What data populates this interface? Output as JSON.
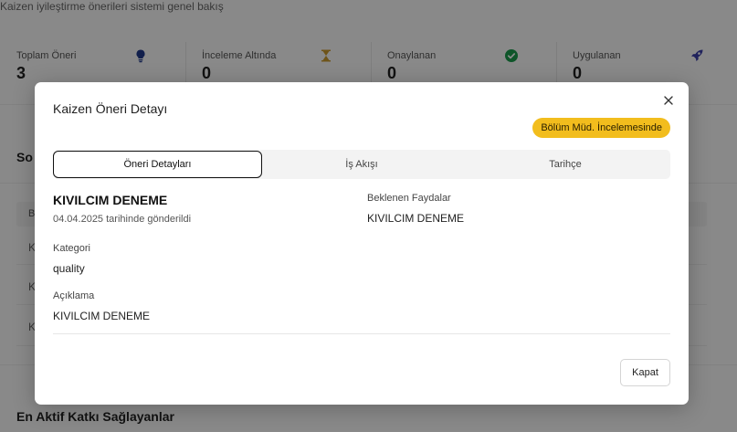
{
  "page": {
    "subtitle": "Kaizen iyileştirme önerileri sistemi genel bakış",
    "stats": [
      {
        "label": "Toplam Öneri",
        "value": "3",
        "icon": "lightbulb-icon",
        "icon_color": "#1f3a8a"
      },
      {
        "label": "İnceleme Altında",
        "value": "0",
        "icon": "hourglass-icon",
        "icon_color": "#c99a2e"
      },
      {
        "label": "Onaylanan",
        "value": "0",
        "icon": "check-circle-icon",
        "icon_color": "#1a9b4b"
      },
      {
        "label": "Uygulanan",
        "value": "0",
        "icon": "rocket-icon",
        "icon_color": "#3b3fa8"
      }
    ],
    "section_recent_title_stub": "So",
    "row_stubs": [
      "K",
      "K",
      "K"
    ],
    "table_head_stub": "B",
    "section_contributors_title": "En Aktif Katkı Sağlayanlar"
  },
  "modal": {
    "title": "Kaizen Öneri Detayı",
    "status_badge": "Bölüm Müd. İncelemesinde",
    "status_color": "#f2bd1d",
    "tabs": [
      {
        "label": "Öneri Detayları",
        "active": true
      },
      {
        "label": "İş Akışı",
        "active": false
      },
      {
        "label": "Tarihçe",
        "active": false
      }
    ],
    "suggestion": {
      "title": "KIVILCIM DENEME",
      "submitted": "04.04.2025 tarihinde gönderildi",
      "category_label": "Kategori",
      "category_value": "quality",
      "description_label": "Açıklama",
      "description_value": "KIVILCIM DENEME",
      "benefits_label": "Beklenen Faydalar",
      "benefits_value": "KIVILCIM DENEME"
    },
    "close_button": "Kapat"
  }
}
